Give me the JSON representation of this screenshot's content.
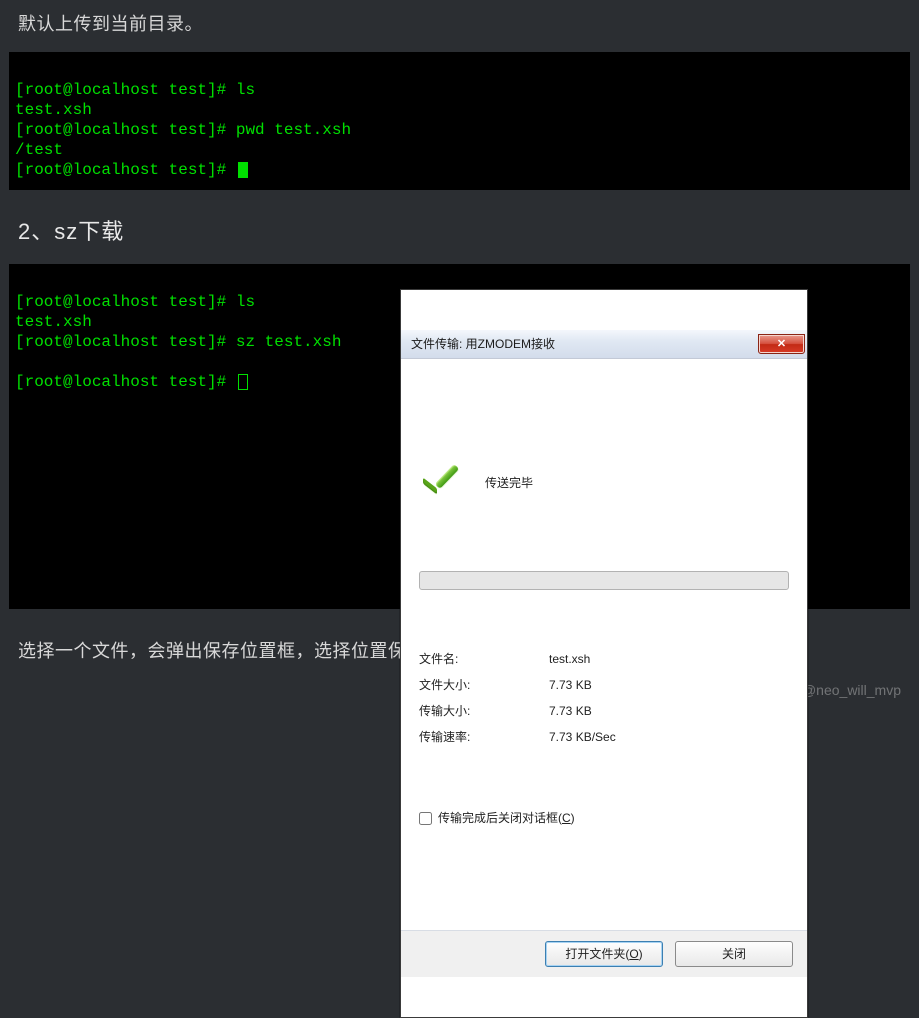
{
  "intro_text": "默认上传到当前目录。",
  "terminal1": {
    "l1": "[root@localhost test]# ls",
    "l2": "test.xsh",
    "l3": "[root@localhost test]# pwd test.xsh",
    "l4": "/test",
    "l5": "[root@localhost test]# "
  },
  "heading": "2、sz下载",
  "terminal2": {
    "l1": "[root@localhost test]# ls",
    "l2": "test.xsh",
    "l3": "[root@localhost test]# sz test.xsh",
    "l4": "",
    "l5": "[root@localhost test]# "
  },
  "dialog": {
    "title": "文件传输: 用ZMODEM接收",
    "status": "传送完毕",
    "rows": {
      "filename_label": "文件名:",
      "filename_value": "test.xsh",
      "filesize_label": "文件大小:",
      "filesize_value": "7.73 KB",
      "xfersize_label": "传输大小:",
      "xfersize_value": "7.73 KB",
      "speed_label": "传输速率:",
      "speed_value": "7.73 KB/Sec"
    },
    "checkbox_label_pre": "传输完成后关闭对话框(",
    "checkbox_accel": "C",
    "checkbox_label_post": ")",
    "open_btn_pre": "打开文件夹(",
    "open_btn_accel": "O",
    "open_btn_post": ")",
    "close_btn": "关闭"
  },
  "outro_text": "选择一个文件，会弹出保存位置框，选择位置保存即可。",
  "watermark": "CSDN @neo_will_mvp"
}
